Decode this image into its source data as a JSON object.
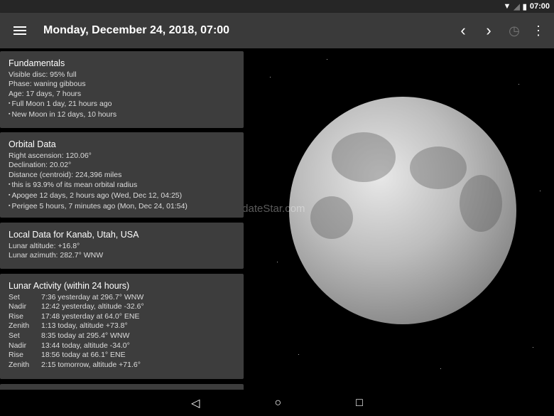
{
  "status": {
    "time": "07:00"
  },
  "toolbar": {
    "title": "Monday, December 24, 2018, 07:00"
  },
  "watermark": "UpdateStar.com",
  "cards": {
    "fundamentals": {
      "title": "Fundamentals",
      "lines": [
        "Visible disc: 95% full",
        "Phase: waning gibbous",
        "Age: 17 days, 7 hours"
      ],
      "bullets": [
        "Full Moon 1 day, 21 hours ago",
        "New Moon in 12 days, 10 hours"
      ]
    },
    "orbital": {
      "title": "Orbital Data",
      "lines": [
        "Right ascension: 120.06°",
        "Declination: 20.02°",
        "Distance (centroid): 224,396 miles"
      ],
      "bullets": [
        "this is 93.9% of its mean orbital radius",
        "Apogee 12 days, 2 hours ago (Wed, Dec 12, 04:25)",
        "Perigee 5 hours, 7 minutes ago (Mon, Dec 24, 01:54)"
      ]
    },
    "local": {
      "title": "Local Data for Kanab, Utah, USA",
      "lines": [
        "Lunar altitude: +16.8°",
        "Lunar azimuth: 282.7° WNW"
      ]
    },
    "activity": {
      "title": "Lunar Activity (within 24 hours)",
      "rows": [
        [
          "Set",
          "7:36 yesterday at 296.7° WNW"
        ],
        [
          "Nadir",
          "12:42 yesterday, altitude -32.6°"
        ],
        [
          "Rise",
          "17:48 yesterday at 64.0° ENE"
        ],
        [
          "Zenith",
          "1:13 today, altitude +73.8°"
        ],
        [
          "Set",
          "8:35 today at 295.4° WNW"
        ],
        [
          "Nadir",
          "13:44 today, altitude -34.0°"
        ],
        [
          "Rise",
          "18:56 today at 66.1° ENE"
        ],
        [
          "Zenith",
          "2:15 tomorrow, altitude +71.6°"
        ]
      ]
    }
  }
}
